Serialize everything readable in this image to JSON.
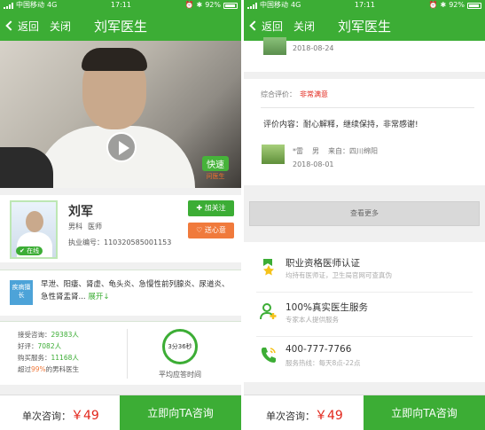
{
  "status_bar": {
    "carrier": "中国移动",
    "network": "4G",
    "time": "17:11",
    "battery": "92%"
  },
  "nav": {
    "back_label": "返回",
    "close_label": "关闭",
    "title": "刘军医生"
  },
  "video": {
    "badge_main": "快速",
    "badge_sub": "问医生"
  },
  "doctor": {
    "name": "刘军",
    "department": "男科",
    "title": "医师",
    "license": "执业编号：110320585001153",
    "online_label": "在线",
    "follow_label": "加关注",
    "gift_label": "送心意"
  },
  "skills": {
    "tag": "疾病擅长",
    "text": "早泄、阳痿、肾虚、龟头炎、急慢性前列腺炎、尿道炎、急性肾盂肾...",
    "expand": "展开"
  },
  "stats": {
    "consult_label": "接受咨询：",
    "consult_value": "29383人",
    "praise_label": "好评：",
    "praise_value": "7082人",
    "service_label": "购买服务：",
    "service_value": "11168人",
    "exceed_prefix": "超过",
    "exceed_value": "99%",
    "exceed_suffix": "的男科医生",
    "avg_time": "3分36秒",
    "avg_label": "平均应答时间"
  },
  "bottom": {
    "price_label": "单次咨询：",
    "price": "￥49",
    "consult_button": "立即向TA咨询"
  },
  "reviews": {
    "prev_date": "2018-08-24",
    "rating_label": "综合评价：",
    "rating_value": "非常满意",
    "content": "评价内容：耐心解释，继续保持，非常感谢!",
    "user": "*雷",
    "gender": "男",
    "location": "来自：四川绵阳",
    "date": "2018-08-01",
    "more_label": "查看更多"
  },
  "features": [
    {
      "icon": "badge-star-icon",
      "title": "职业资格医师认证",
      "subtitle": "均持有医师证，卫生局官网可查真伪"
    },
    {
      "icon": "user-plus-icon",
      "title": "100%真实医生服务",
      "subtitle": "专家本人提供服务"
    },
    {
      "icon": "phone-icon",
      "title": "400-777-7766",
      "subtitle": "服务热线：每天8点-22点"
    }
  ],
  "colors": {
    "brand_green": "#3cad35",
    "accent_orange": "#f07a3c",
    "price_red": "#e2261b"
  }
}
